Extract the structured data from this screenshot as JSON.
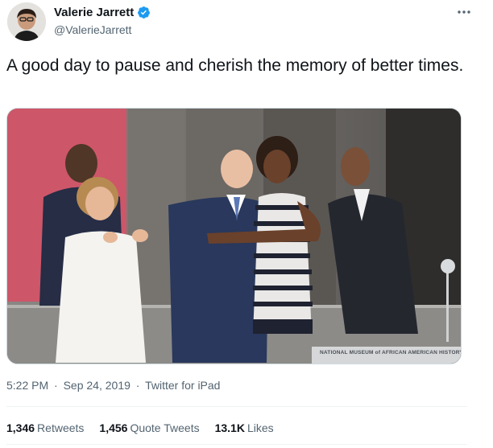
{
  "author": {
    "display_name": "Valerie Jarrett",
    "handle": "@ValerieJarrett",
    "verified_icon": "verified-badge-icon",
    "avatar_icon": "avatar"
  },
  "tweet": {
    "text": "A good day to pause and cherish the memory of better times.",
    "image_caption": "NATIONAL MUSEUM of AFRICAN AMERICAN HISTORY"
  },
  "meta": {
    "time": "5:22 PM",
    "separator": "·",
    "date": "Sep 24, 2019",
    "source": "Twitter for iPad"
  },
  "stats": {
    "retweets_count": "1,346",
    "retweets_label": "Retweets",
    "quotes_count": "1,456",
    "quotes_label": "Quote Tweets",
    "likes_count": "13.1K",
    "likes_label": "Likes"
  },
  "colors": {
    "verified": "#1d9bf0",
    "text_primary": "#0f1419",
    "text_secondary": "#536471"
  }
}
